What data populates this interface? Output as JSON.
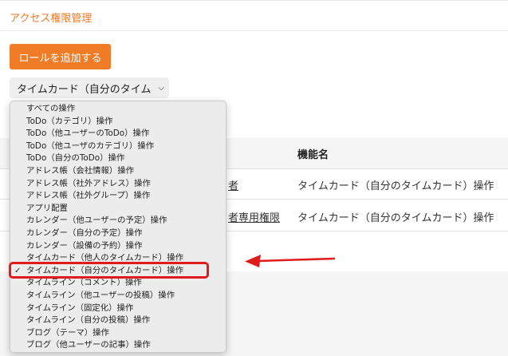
{
  "page": {
    "title": "アクセス権限管理",
    "add_role_label": "ロールを追加する"
  },
  "select": {
    "selected_value": "タイムカード（自分のタイム"
  },
  "table": {
    "header_function": "機能名",
    "rows": [
      {
        "left": "者",
        "function": "タイムカード（自分のタイムカード）操作"
      },
      {
        "left": "者専用権限",
        "function": "タイムカード（自分のタイムカード）操作"
      }
    ]
  },
  "dropdown": {
    "options": [
      "すべての操作",
      "ToDo（カテゴリ）操作",
      "ToDo（他ユーザーのToDo）操作",
      "ToDo（他ユーザのカテゴリ）操作",
      "ToDo（自分のToDo）操作",
      "アドレス帳（会社情報）操作",
      "アドレス帳（社外アドレス）操作",
      "アドレス帳（社外グループ）操作",
      "アプリ配置",
      "カレンダー（他ユーザーの予定）操作",
      "カレンダー（自分の予定）操作",
      "カレンダー（設備の予約）操作",
      "タイムカード（他人のタイムカード）操作",
      "タイムカード（自分のタイムカード）操作",
      "タイムライン（コメント）操作",
      "タイムライン（他ユーザーの投稿）操作",
      "タイムライン（固定化）操作",
      "タイムライン（自分の投稿）操作",
      "ブログ（テーマ）操作",
      "ブログ（他ユーザーの記事）操作"
    ],
    "selected_index": 13,
    "check_mark": "✓"
  },
  "colors": {
    "accent": "#f07c28",
    "title": "#ee7a2a",
    "annotation_red": "#e01b1b"
  }
}
